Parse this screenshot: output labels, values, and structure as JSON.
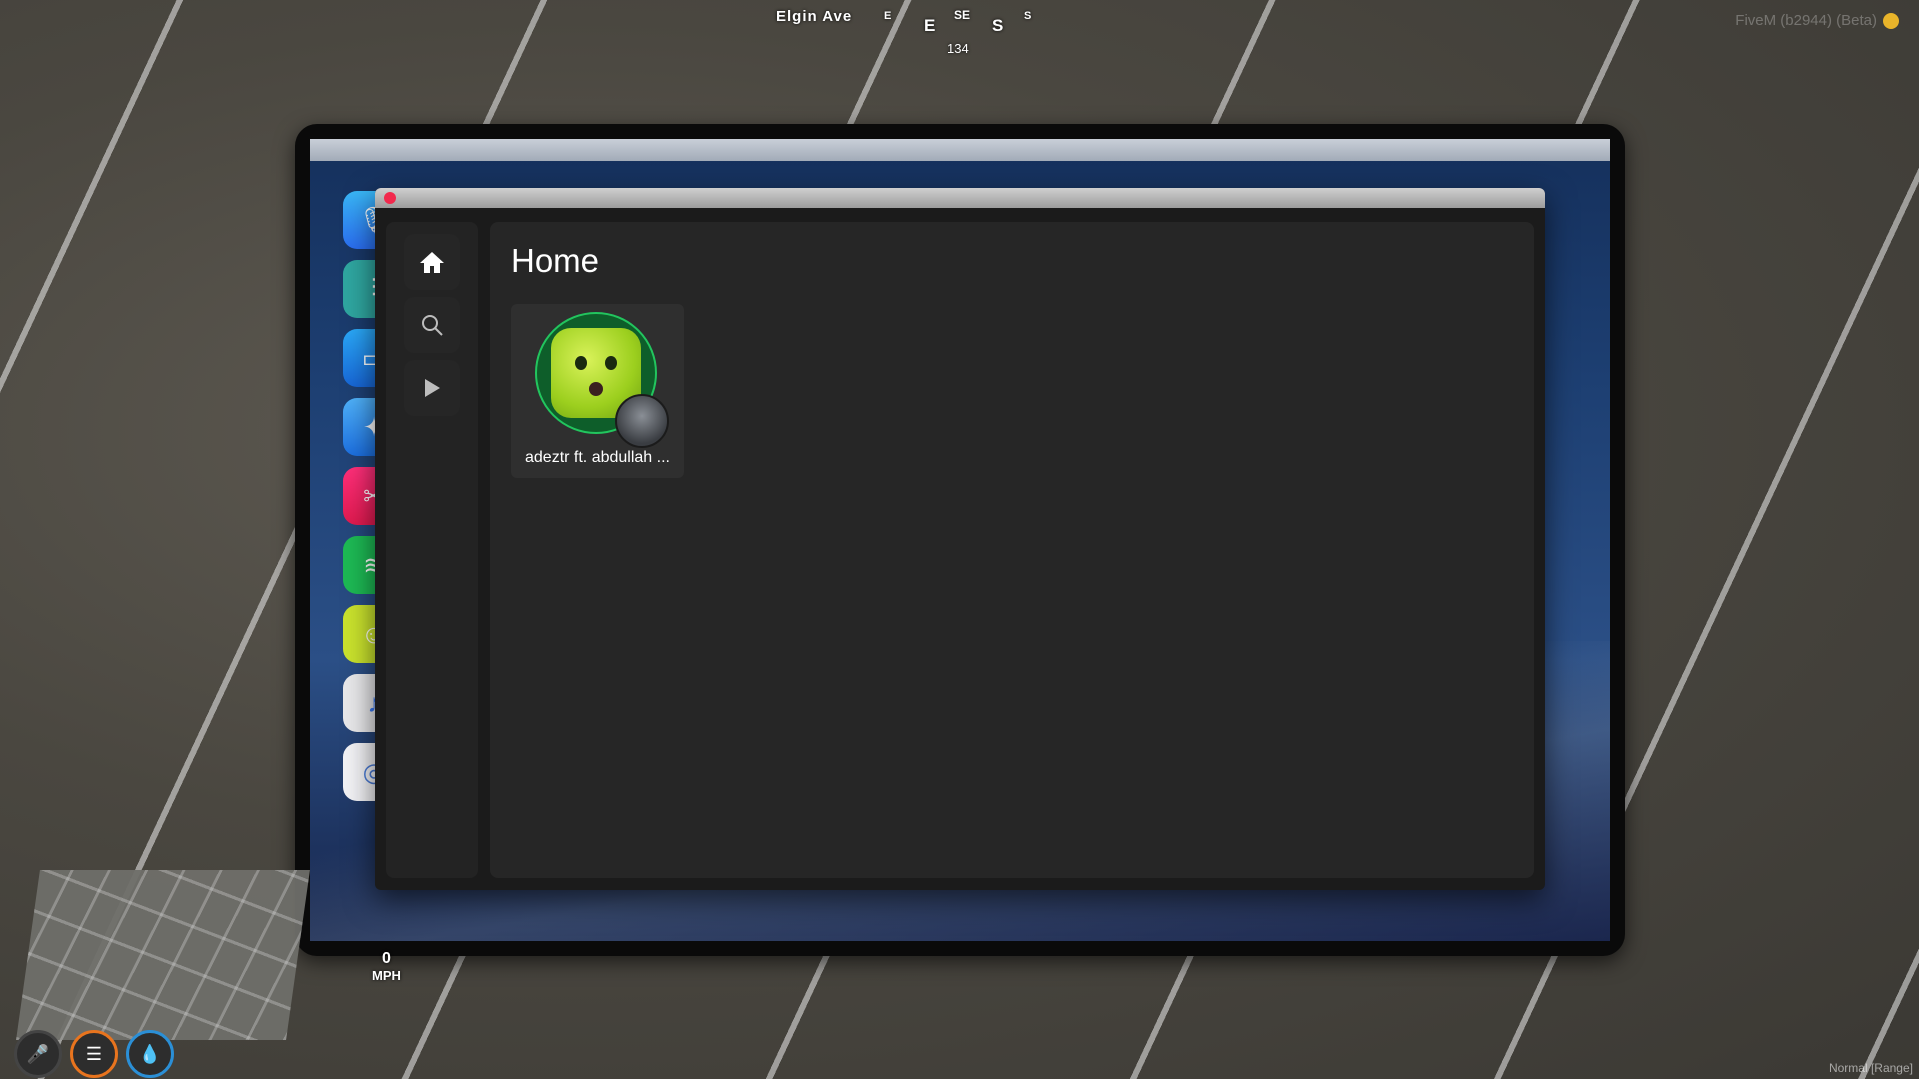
{
  "hud": {
    "street": "Elgin Ave",
    "compass": [
      "E",
      "E",
      "SE",
      "S",
      "S"
    ],
    "heading": "134",
    "fivem_version": "FiveM (b2944) (Beta)",
    "mode": "Normal [Range]",
    "speed": {
      "value": "0",
      "unit": "MPH"
    }
  },
  "dock": {
    "icons": [
      "siri-icon",
      "equalizer-icon",
      "files-icon",
      "safari-icon",
      "bolt-icon",
      "spotify-icon",
      "emoji-app-icon",
      "music-icon",
      "fingerprint-icon"
    ]
  },
  "app": {
    "page_title": "Home",
    "sidebar": [
      "home-icon",
      "search-icon",
      "play-icon"
    ],
    "card": {
      "title": "adeztr ft. abdullah ..."
    }
  },
  "colors": {
    "accent_green": "#22c55e",
    "close_red": "#f2294d"
  }
}
